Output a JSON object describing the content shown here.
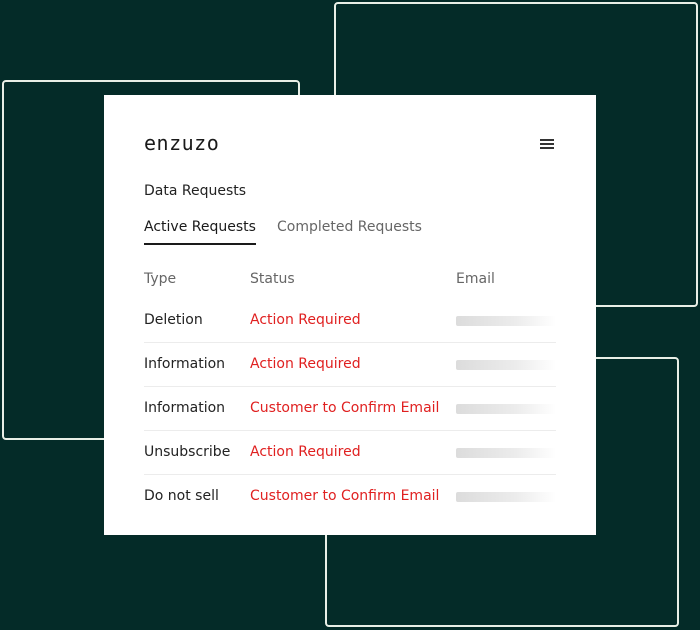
{
  "app": {
    "logo": "enzuzo"
  },
  "header": {
    "menu_icon": "hamburger-menu-icon"
  },
  "page": {
    "title": "Data Requests"
  },
  "tabs": [
    {
      "label": "Active Requests",
      "active": true
    },
    {
      "label": "Completed Requests",
      "active": false
    }
  ],
  "table": {
    "columns": [
      "Type",
      "Status",
      "Email"
    ],
    "rows": [
      {
        "type": "Deletion",
        "status": "Action Required"
      },
      {
        "type": "Information",
        "status": "Action Required"
      },
      {
        "type": "Information",
        "status": "Customer to Confirm Email"
      },
      {
        "type": "Unsubscribe",
        "status": "Action Required"
      },
      {
        "type": "Do not sell",
        "status": "Customer to Confirm Email"
      }
    ]
  },
  "colors": {
    "background": "#042b28",
    "status_red": "#e02020",
    "card": "#ffffff"
  }
}
